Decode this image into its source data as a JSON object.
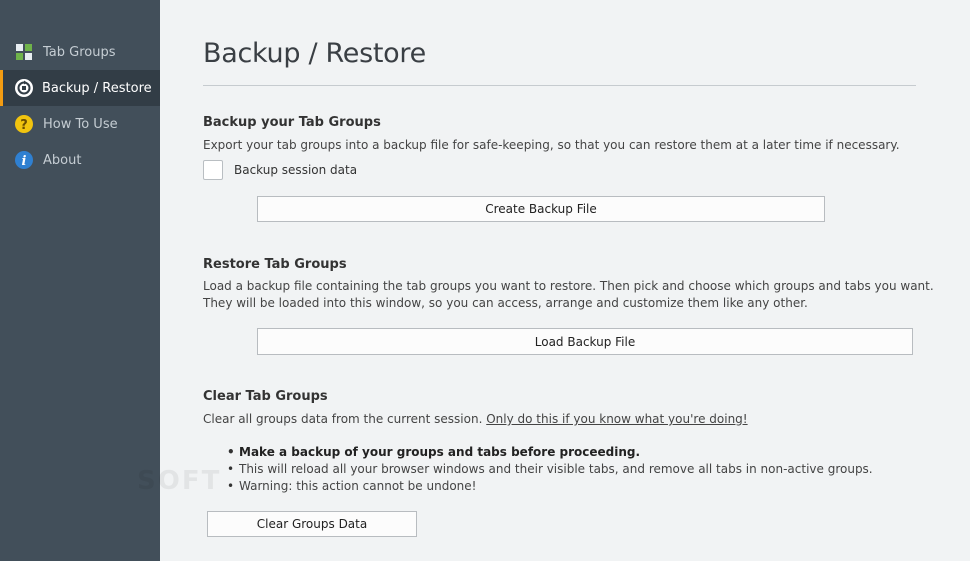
{
  "sidebar": {
    "items": [
      {
        "label": "Tab Groups",
        "icon": "tab-groups-icon",
        "active": false
      },
      {
        "label": "Backup / Restore",
        "icon": "backup-restore-icon",
        "active": true
      },
      {
        "label": "How To Use",
        "icon": "help-icon",
        "active": false
      },
      {
        "label": "About",
        "icon": "info-icon",
        "active": false
      }
    ]
  },
  "page": {
    "title": "Backup / Restore"
  },
  "backup": {
    "title": "Backup your Tab Groups",
    "description": "Export your tab groups into a backup file for safe-keeping, so that you can restore them at a later time if necessary.",
    "checkbox_label": "Backup session data",
    "checkbox_checked": false,
    "button_label": "Create Backup File"
  },
  "restore": {
    "title": "Restore Tab Groups",
    "description_line1": "Load a backup file containing the tab groups you want to restore. Then pick and choose which groups and tabs you want.",
    "description_line2": "They will be loaded into this window, so you can access, arrange and customize them like any other.",
    "button_label": "Load Backup File"
  },
  "clear": {
    "title": "Clear Tab Groups",
    "description": "Clear all groups data from the current session.",
    "link_text": "Only do this if you know what you're doing!",
    "bullets": [
      "Make a backup of your groups and tabs before proceeding.",
      "This will reload all your browser windows and their visible tabs, and remove all tabs in non-active groups.",
      "Warning: this action cannot be undone!"
    ],
    "button_label": "Clear Groups Data"
  },
  "watermark": "SOFT",
  "colors": {
    "sidebar_bg": "#424f5a",
    "sidebar_active_bg": "#323d46",
    "accent": "#f39c12",
    "content_bg": "#f1f3f4"
  }
}
